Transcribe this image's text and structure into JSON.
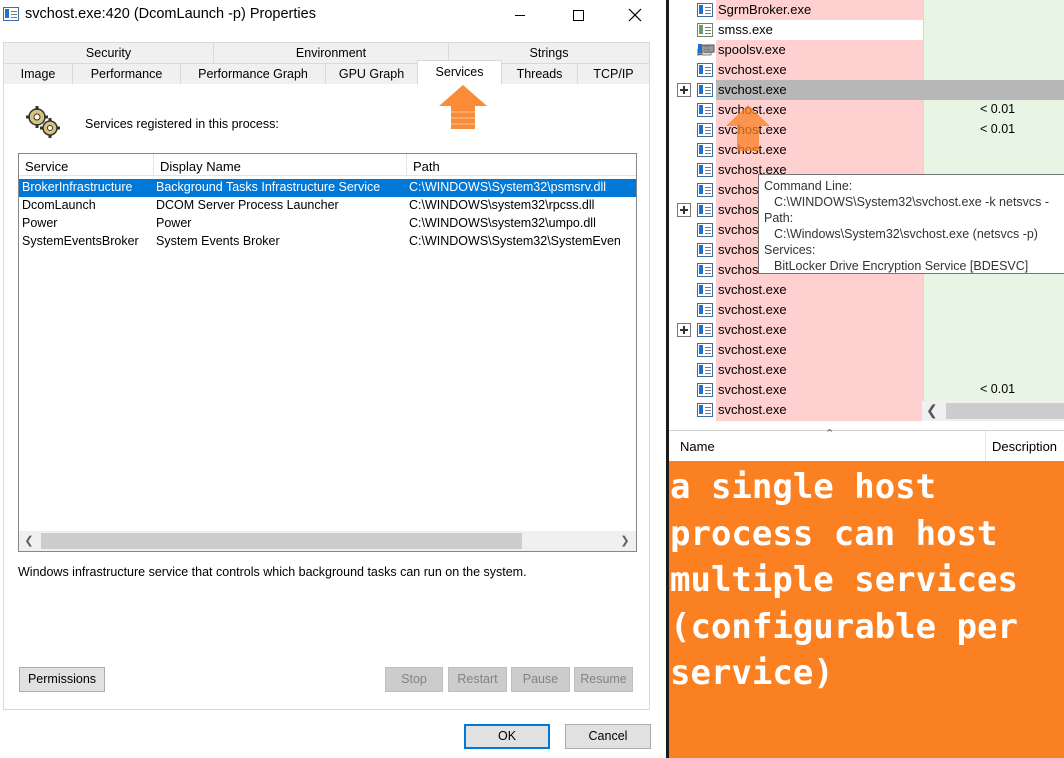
{
  "window": {
    "title": "svchost.exe:420 (DcomLaunch -p) Properties",
    "minimize_icon": "minimize-icon",
    "maximize_icon": "maximize-icon",
    "close_icon": "close-icon"
  },
  "tabs": {
    "row1": [
      {
        "label": "Security"
      },
      {
        "label": "Environment"
      },
      {
        "label": "Strings"
      }
    ],
    "row2": [
      {
        "label": "Image"
      },
      {
        "label": "Performance"
      },
      {
        "label": "Performance Graph"
      },
      {
        "label": "GPU Graph"
      },
      {
        "label": "Services"
      },
      {
        "label": "Threads"
      },
      {
        "label": "TCP/IP"
      }
    ],
    "active": "Services"
  },
  "services_panel": {
    "header": "Services registered in this process:",
    "columns": [
      "Service",
      "Display Name",
      "Path"
    ],
    "rows": [
      {
        "service": "BrokerInfrastructure",
        "display_name": "Background Tasks Infrastructure Service",
        "path": "C:\\WINDOWS\\System32\\psmsrv.dll",
        "selected": true
      },
      {
        "service": "DcomLaunch",
        "display_name": "DCOM Server Process Launcher",
        "path": "C:\\WINDOWS\\system32\\rpcss.dll",
        "selected": false
      },
      {
        "service": "Power",
        "display_name": "Power",
        "path": "C:\\WINDOWS\\system32\\umpo.dll",
        "selected": false
      },
      {
        "service": "SystemEventsBroker",
        "display_name": "System Events Broker",
        "path": "C:\\WINDOWS\\System32\\SystemEven",
        "selected": false
      }
    ],
    "description": "Windows infrastructure service that controls which background tasks can run on the system."
  },
  "buttons": {
    "permissions": "Permissions",
    "stop": "Stop",
    "restart": "Restart",
    "pause": "Pause",
    "resume": "Resume",
    "ok": "OK",
    "cancel": "Cancel"
  },
  "process_list": {
    "rows": [
      {
        "name": "SgrmBroker.exe",
        "cpu": "",
        "icon": "process-icon",
        "expander": false
      },
      {
        "name": "smss.exe",
        "cpu": "",
        "icon": "process-icon",
        "expander": false
      },
      {
        "name": "spoolsv.exe",
        "cpu": "",
        "icon": "printer-icon",
        "expander": false
      },
      {
        "name": "svchost.exe",
        "cpu": "",
        "icon": "process-icon",
        "expander": false
      },
      {
        "name": "svchost.exe",
        "cpu": "",
        "icon": "process-icon",
        "expander": true
      },
      {
        "name": "svchost.exe",
        "cpu": "< 0.01",
        "icon": "process-icon",
        "expander": false
      },
      {
        "name": "svchost.exe",
        "cpu": "< 0.01",
        "icon": "process-icon",
        "expander": false
      },
      {
        "name": "svchost.exe",
        "cpu": "",
        "icon": "process-icon",
        "expander": false
      },
      {
        "name": "svchost.exe",
        "cpu": "",
        "icon": "process-icon",
        "expander": false
      },
      {
        "name": "svchost.exe",
        "cpu": "",
        "icon": "process-icon",
        "expander": false
      },
      {
        "name": "svchost.exe",
        "cpu": "",
        "icon": "process-icon",
        "expander": true
      },
      {
        "name": "svchost.exe",
        "cpu": "",
        "icon": "process-icon",
        "expander": false
      },
      {
        "name": "svchost.exe",
        "cpu": "",
        "icon": "process-icon",
        "expander": false
      },
      {
        "name": "svchost.exe",
        "cpu": "",
        "icon": "process-icon",
        "expander": false
      },
      {
        "name": "svchost.exe",
        "cpu": "",
        "icon": "process-icon",
        "expander": false
      },
      {
        "name": "svchost.exe",
        "cpu": "",
        "icon": "process-icon",
        "expander": false
      },
      {
        "name": "svchost.exe",
        "cpu": "",
        "icon": "process-icon",
        "expander": true
      },
      {
        "name": "svchost.exe",
        "cpu": "",
        "icon": "process-icon",
        "expander": false
      },
      {
        "name": "svchost.exe",
        "cpu": "",
        "icon": "process-icon",
        "expander": false
      },
      {
        "name": "svchost.exe",
        "cpu": "< 0.01",
        "icon": "process-icon",
        "expander": false
      },
      {
        "name": "svchost.exe",
        "cpu": "",
        "icon": "process-icon",
        "expander": false
      }
    ],
    "tooltip": {
      "command_line_label": "Command Line:",
      "command_line": "C:\\WINDOWS\\System32\\svchost.exe -k netsvcs -",
      "path_label": "Path:",
      "path": "C:\\Windows\\System32\\svchost.exe (netsvcs -p)",
      "services_label": "Services:",
      "services": "BitLocker Drive Encryption Service [BDESVC]"
    }
  },
  "lower_pane": {
    "columns": [
      "Name",
      "Description"
    ]
  },
  "caption": "a single host process can host multiple services (configurable per service)",
  "colors": {
    "selection": "#0078d7",
    "highlight_arrow": "#fb8021",
    "process_pink": "#ffd0d0",
    "caption_bg": "#fb8021"
  }
}
